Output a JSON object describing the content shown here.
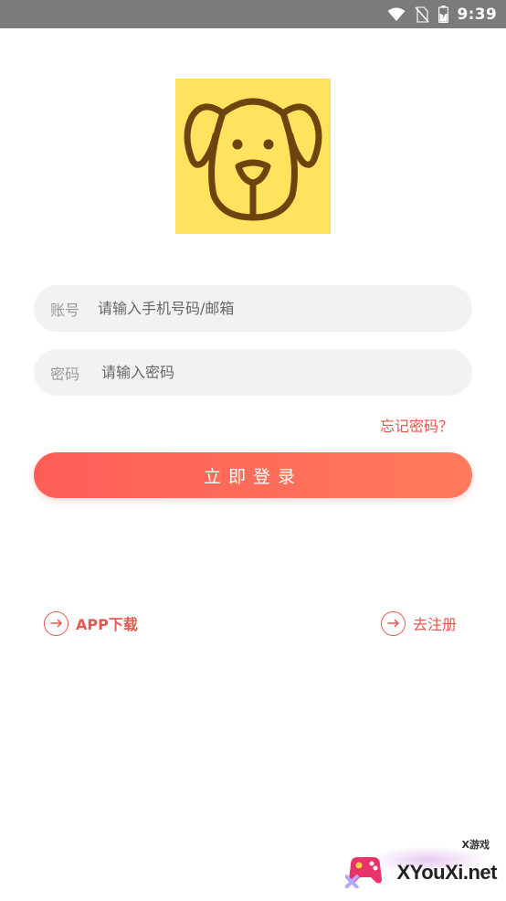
{
  "status_bar": {
    "time": "9:39",
    "icons": [
      "wifi-icon",
      "no-sim-icon",
      "battery-charging-icon"
    ]
  },
  "logo": {
    "icon": "dog-face-icon",
    "background": "#ffe25e",
    "stroke": "#6b4410"
  },
  "form": {
    "account_label": "账号",
    "account_placeholder": "请输入手机号码/邮箱",
    "password_label": "密码",
    "password_placeholder": "请输入密码",
    "forgot_password": "忘记密码？",
    "login_button": "立即登录"
  },
  "bottom_links": {
    "app_download": "APP下载",
    "register": "去注册"
  },
  "watermark": {
    "main": "XYouXi.net",
    "sub": "X游戏"
  },
  "colors": {
    "accent": "#e8554f",
    "button_start": "#ff5e57",
    "button_end": "#ff7a5c"
  }
}
